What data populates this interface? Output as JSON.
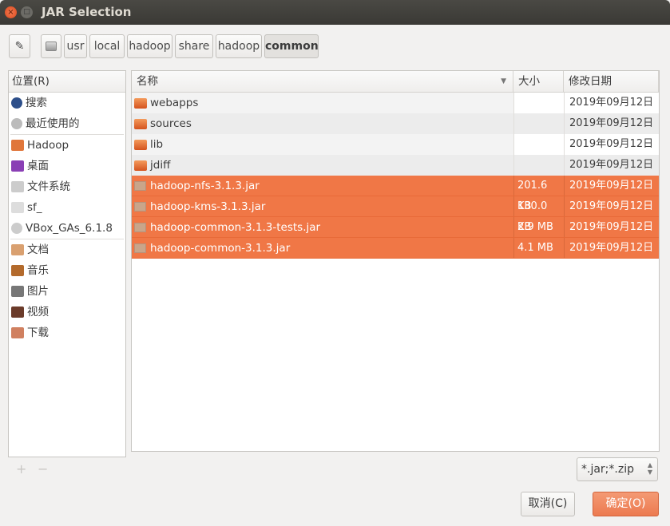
{
  "window": {
    "title": "JAR Selection",
    "close": "×",
    "minimize": "□"
  },
  "path": {
    "edit_icon": "pencil-icon",
    "drive_icon": "drive-icon",
    "segments": [
      "usr",
      "local",
      "hadoop",
      "share",
      "hadoop",
      "common"
    ]
  },
  "sidebar": {
    "header": "位置(R)",
    "groups": [
      [
        {
          "label": "搜索",
          "icon": "search-icon"
        },
        {
          "label": "最近使用的",
          "icon": "recent-icon"
        }
      ],
      [
        {
          "label": "Hadoop",
          "icon": "home-folder-icon"
        },
        {
          "label": "桌面",
          "icon": "desktop-icon"
        },
        {
          "label": "文件系统",
          "icon": "filesystem-icon"
        },
        {
          "label": "sf_",
          "icon": "drive-icon"
        },
        {
          "label": "VBox_GAs_6.1.8",
          "icon": "disc-icon"
        }
      ],
      [
        {
          "label": "文档",
          "icon": "documents-icon"
        },
        {
          "label": "音乐",
          "icon": "music-icon"
        },
        {
          "label": "图片",
          "icon": "pictures-icon"
        },
        {
          "label": "视频",
          "icon": "videos-icon"
        },
        {
          "label": "下载",
          "icon": "downloads-icon"
        }
      ]
    ]
  },
  "files": {
    "columns": {
      "name": "名称",
      "size": "大小",
      "modified": "修改日期"
    },
    "rows": [
      {
        "name": "webapps",
        "size": "",
        "modified": "2019年09月12日",
        "type": "folder",
        "selected": false
      },
      {
        "name": "sources",
        "size": "",
        "modified": "2019年09月12日",
        "type": "folder",
        "selected": false
      },
      {
        "name": "lib",
        "size": "",
        "modified": "2019年09月12日",
        "type": "folder",
        "selected": false
      },
      {
        "name": "jdiff",
        "size": "",
        "modified": "2019年09月12日",
        "type": "folder",
        "selected": false
      },
      {
        "name": "hadoop-nfs-3.1.3.jar",
        "size": "201.6 KB",
        "modified": "2019年09月12日",
        "type": "jar",
        "selected": true
      },
      {
        "name": "hadoop-kms-3.1.3.jar",
        "size": "130.0 KB",
        "modified": "2019年09月12日",
        "type": "jar",
        "selected": true
      },
      {
        "name": "hadoop-common-3.1.3-tests.jar",
        "size": "2.9 MB",
        "modified": "2019年09月12日",
        "type": "jar",
        "selected": true
      },
      {
        "name": "hadoop-common-3.1.3.jar",
        "size": "4.1 MB",
        "modified": "2019年09月12日",
        "type": "jar",
        "selected": true
      }
    ]
  },
  "bookmarks": {
    "add": "+",
    "remove": "−"
  },
  "filter": {
    "value": "*.jar;*.zip"
  },
  "buttons": {
    "cancel": "取消(C)",
    "ok": "确定(O)"
  },
  "colors": {
    "accent": "#f07746",
    "titlebar": "#3c3b37"
  }
}
